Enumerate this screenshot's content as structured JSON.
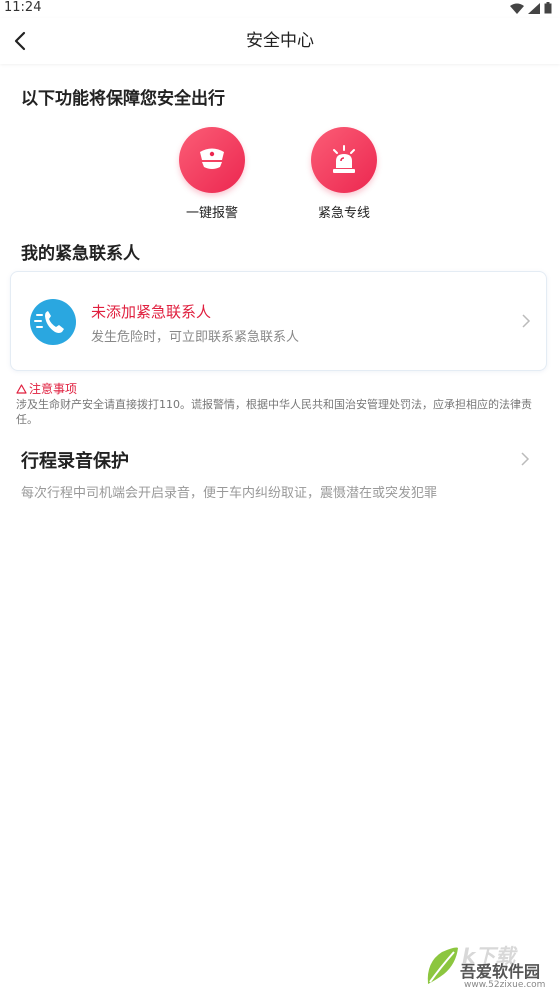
{
  "status_bar": {
    "time": "11:24"
  },
  "nav": {
    "title": "安全中心"
  },
  "features": {
    "heading": "以下功能将保障您安全出行",
    "items": [
      {
        "label": "一键报警",
        "icon": "police-cap-icon"
      },
      {
        "label": "紧急专线",
        "icon": "siren-icon"
      }
    ]
  },
  "contacts": {
    "heading": "我的紧急联系人",
    "card": {
      "title": "未添加紧急联系人",
      "subtitle": "发生危险时，可立即联系紧急联系人"
    }
  },
  "notice": {
    "title": "注意事项",
    "body": "涉及生命财产安全请直接拨打110。谎报警情，根据中华人民共和国治安管理处罚法，应承担相应的法律责任。"
  },
  "recording": {
    "title": "行程录音保护",
    "description": "每次行程中司机端会开启录音，便于车内纠纷取证，震慑潜在或突发犯罪"
  },
  "watermark": {
    "line1": "k下载",
    "line2": "吾爱软件园",
    "line3": "www.52zixue.com"
  },
  "colors": {
    "accent_red": "#ec2750",
    "phone_blue": "#2aa7e0"
  }
}
